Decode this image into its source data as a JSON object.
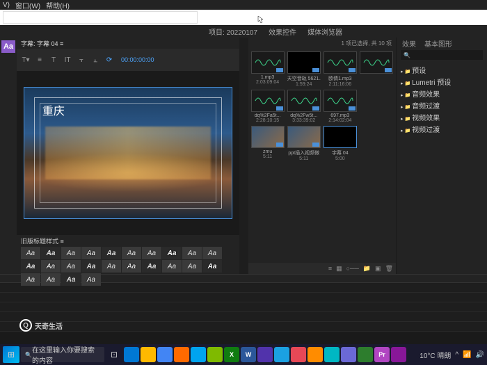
{
  "menubar": {
    "items": [
      "V)",
      "窗口(W)",
      "帮助(H)"
    ]
  },
  "top_tabs": {
    "project": "项目: 20220107",
    "effect_controls": "效果控件",
    "media_browser": "媒体浏览器"
  },
  "right_tabs": {
    "effects": "效果",
    "essential_graphics": "基本图形"
  },
  "title_panel": {
    "header": "字幕: 字幕 04 ≡",
    "timecode": "00:00:00:00",
    "title_text": "重庆",
    "styles_label": "旧版标题样式 ≡"
  },
  "style_swatches": [
    "Aa",
    "Aa",
    "Aa",
    "Aa",
    "Aa",
    "Aa",
    "Aa",
    "Aa",
    "Aa",
    "Aa",
    "Aa",
    "Aa",
    "Aa",
    "Aa",
    "Aa",
    "Aa",
    "Aa",
    "Aa",
    "Aa",
    "Aa",
    "Aa",
    "Aa",
    "Aa",
    "Aa"
  ],
  "project": {
    "status": "1 项已选择, 共 10 项",
    "clips": [
      {
        "name": "1.mp3",
        "dur": "2:03:09:04",
        "type": "audio"
      },
      {
        "name": "天空音轨 5621...",
        "dur": "1:59:24",
        "type": "video-black"
      },
      {
        "name": "欧倩1.mp3",
        "dur": "2:11:16:06",
        "type": "audio"
      },
      {
        "name": "",
        "dur": "",
        "type": "audio"
      },
      {
        "name": "dq%2Fa5t...",
        "dur": "2:28:10:15",
        "type": "audio"
      },
      {
        "name": "dq%2Fw5t...",
        "dur": "3:33:39:02",
        "type": "audio"
      },
      {
        "name": "697.mp3",
        "dur": "2:14:02:04",
        "type": "audio"
      },
      {
        "name": "",
        "dur": "",
        "type": "empty"
      },
      {
        "name": "zmu",
        "dur": "5:11",
        "type": "image"
      },
      {
        "name": "ppt插入视频做",
        "dur": "5:11",
        "type": "image"
      },
      {
        "name": "字幕 04",
        "dur": "5:00",
        "type": "title",
        "selected": true
      }
    ]
  },
  "effects_tree": [
    "预设",
    "Lumetri 预设",
    "音频效果",
    "音频过渡",
    "视频效果",
    "视频过渡"
  ],
  "watermark": "天奇生活",
  "taskbar": {
    "search_placeholder": "在这里输入你要搜索的内容",
    "weather": "10°C 晴朗",
    "apps": [
      {
        "bg": "#0078d4",
        "txt": ""
      },
      {
        "bg": "#ffb900",
        "txt": ""
      },
      {
        "bg": "#4285f4",
        "txt": ""
      },
      {
        "bg": "#ff6a00",
        "txt": ""
      },
      {
        "bg": "#00a4ef",
        "txt": ""
      },
      {
        "bg": "#7fba00",
        "txt": ""
      },
      {
        "bg": "#107c10",
        "txt": "X"
      },
      {
        "bg": "#2b579a",
        "txt": "W"
      },
      {
        "bg": "#5133ab",
        "txt": ""
      },
      {
        "bg": "#1ba1e2",
        "txt": ""
      },
      {
        "bg": "#e74856",
        "txt": ""
      },
      {
        "bg": "#ff8c00",
        "txt": ""
      },
      {
        "bg": "#00b7c3",
        "txt": ""
      },
      {
        "bg": "#6b69d6",
        "txt": ""
      },
      {
        "bg": "#2d7d2d",
        "txt": ""
      },
      {
        "bg": "#b146c2",
        "txt": "Pr"
      },
      {
        "bg": "#881798",
        "txt": ""
      }
    ]
  }
}
